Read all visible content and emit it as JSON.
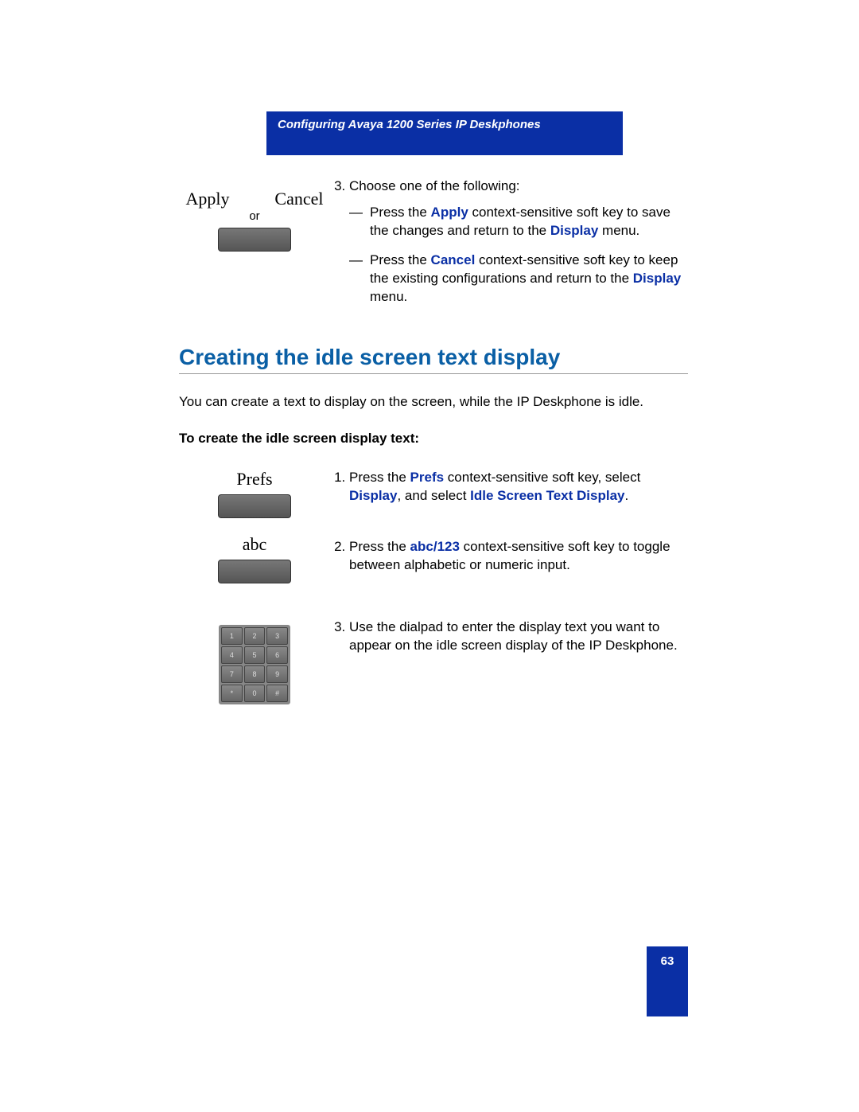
{
  "header": {
    "title": "Configuring Avaya 1200 Series IP Deskphones"
  },
  "top_step": {
    "number_text": "Choose one of the following:",
    "left": {
      "apply": "Apply",
      "cancel": "Cancel",
      "or": "or"
    },
    "bullets": {
      "b1_pre": "Press the ",
      "b1_bold": "Apply",
      "b1_mid": " context-sensitive soft key to save the changes and return to the ",
      "b1_bold2": "Display",
      "b1_post": " menu.",
      "b2_pre": "Press the ",
      "b2_bold": "Cancel",
      "b2_mid": " context-sensitive soft key to keep the existing configurations and return to the ",
      "b2_bold2": "Display",
      "b2_post": " menu."
    }
  },
  "section_title": "Creating the idle screen text display",
  "intro": "You can create a text to display on the screen, while the IP Deskphone is idle.",
  "sub_heading": "To create the idle screen display text:",
  "steps": {
    "s1": {
      "left_label": "Prefs",
      "t1": "Press the ",
      "b1": "Prefs",
      "t2": " context-sensitive soft key, select ",
      "b2": "Display",
      "t3": ", and select ",
      "b3": "Idle Screen Text Display",
      "t4": "."
    },
    "s2": {
      "left_label": "abc",
      "t1": "Press the ",
      "b1": "abc",
      "slash": "/",
      "b2": "123",
      "t2": " context-sensitive soft key to toggle between alphabetic or numeric input."
    },
    "s3": {
      "t1": "Use the dialpad to enter the display text you want to appear on the idle screen display of the IP Deskphone."
    }
  },
  "dialpad_keys": [
    "1",
    "2",
    "3",
    "4",
    "5",
    "6",
    "7",
    "8",
    "9",
    "*",
    "0",
    "#"
  ],
  "page_number": "63"
}
